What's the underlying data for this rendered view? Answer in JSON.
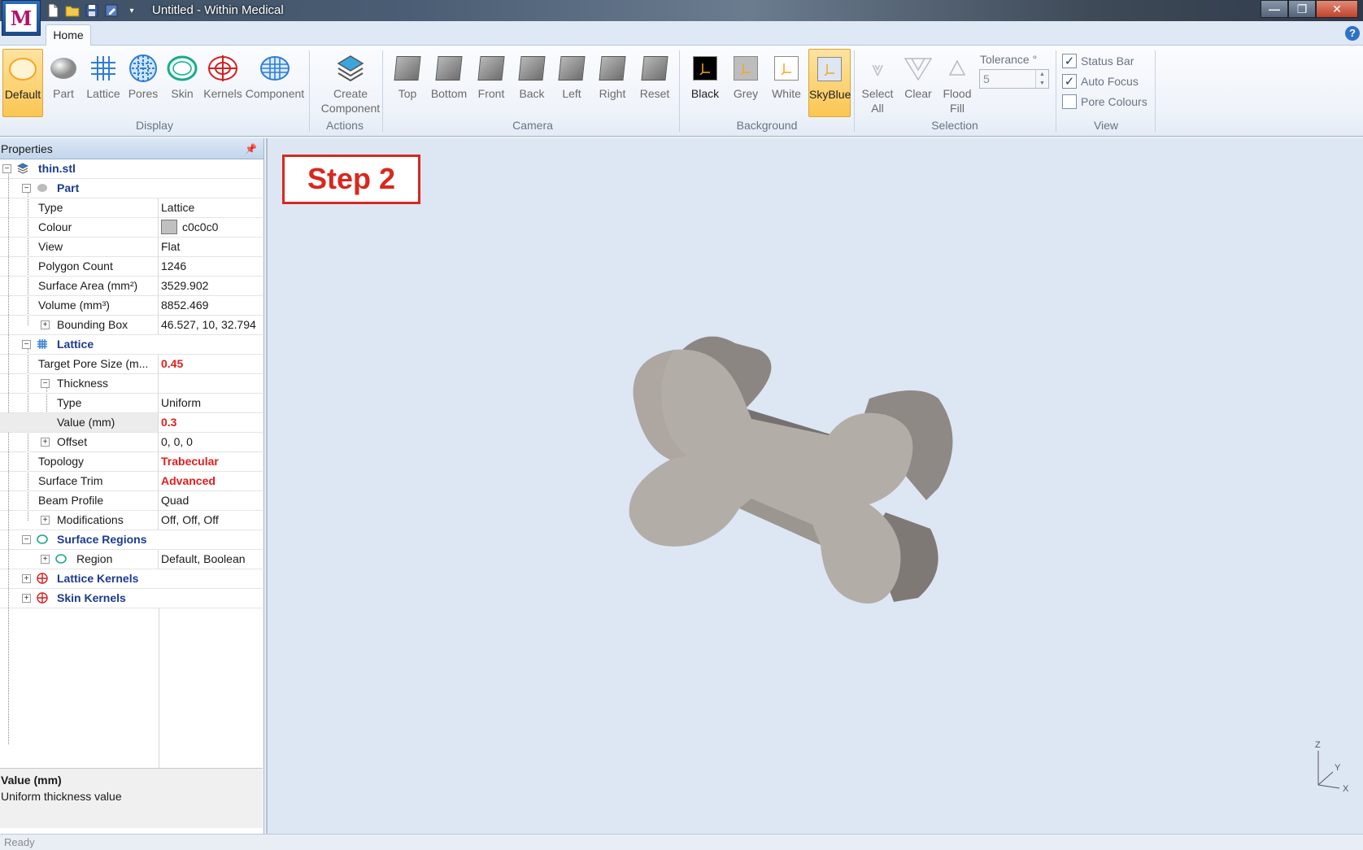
{
  "window": {
    "title": "Untitled - Within Medical",
    "logo_letter": "M",
    "min_label": "—",
    "max_label": "❐",
    "close_label": "✕",
    "help_label": "?"
  },
  "tabs": {
    "home": "Home"
  },
  "ribbon": {
    "display": {
      "label": "Display",
      "buttons": [
        "Default",
        "Part",
        "Lattice",
        "Pores",
        "Skin",
        "Kernels",
        "Component"
      ]
    },
    "actions": {
      "label": "Actions",
      "create_line1": "Create",
      "create_line2": "Component"
    },
    "camera": {
      "label": "Camera",
      "buttons": [
        "Top",
        "Bottom",
        "Front",
        "Back",
        "Left",
        "Right",
        "Reset"
      ]
    },
    "background": {
      "label": "Background",
      "buttons": [
        "Black",
        "Grey",
        "White",
        "SkyBlue"
      ],
      "active": "SkyBlue"
    },
    "selection": {
      "label": "Selection",
      "select_line1": "Select",
      "select_line2": "All",
      "clear": "Clear",
      "flood_line1": "Flood",
      "flood_line2": "Fill",
      "tolerance_label": "Tolerance °",
      "tolerance_value": "5"
    },
    "view": {
      "label": "View",
      "checkboxes": [
        {
          "label": "Status Bar",
          "checked": "✓"
        },
        {
          "label": "Auto Focus",
          "checked": "✓"
        },
        {
          "label": "Pore Colours",
          "checked": ""
        }
      ]
    }
  },
  "properties": {
    "header": "Properties",
    "pin": "📌",
    "root": "thin.stl",
    "part": {
      "label": "Part",
      "type_name": "Type",
      "type_value": "Lattice",
      "colour_name": "Colour",
      "colour_value": "c0c0c0",
      "colour_hex": "#c0c0c0",
      "view_name": "View",
      "view_value": "Flat",
      "poly_name": "Polygon Count",
      "poly_value": "1246",
      "area_name": "Surface Area (mm²)",
      "area_value": "3529.902",
      "volume_name": "Volume (mm³)",
      "volume_value": "8852.469",
      "bbox_name": "Bounding Box",
      "bbox_value": "46.527, 10, 32.794"
    },
    "lattice": {
      "label": "Lattice",
      "pore_name": "Target Pore Size (m...",
      "pore_value": "0.45",
      "thickness_name": "Thickness",
      "ttype_name": "Type",
      "ttype_value": "Uniform",
      "tvalue_name": "Value (mm)",
      "tvalue_value": "0.3",
      "offset_name": "Offset",
      "offset_value": "0, 0, 0",
      "topology_name": "Topology",
      "topology_value": "Trabecular",
      "trim_name": "Surface Trim",
      "trim_value": "Advanced",
      "beam_name": "Beam Profile",
      "beam_value": "Quad",
      "mods_name": "Modifications",
      "mods_value": "Off, Off, Off"
    },
    "surface_regions": {
      "label": "Surface Regions",
      "region_name": "Region",
      "region_value": "Default, Boolean"
    },
    "lattice_kernels": "Lattice Kernels",
    "skin_kernels": "Skin Kernels",
    "description": {
      "title": "Value (mm)",
      "text": "Uniform thickness value"
    }
  },
  "viewport": {
    "step_label": "Step 2",
    "axes": {
      "z": "Z",
      "y": "Y",
      "x": "X"
    }
  },
  "status": {
    "text": "Ready"
  }
}
